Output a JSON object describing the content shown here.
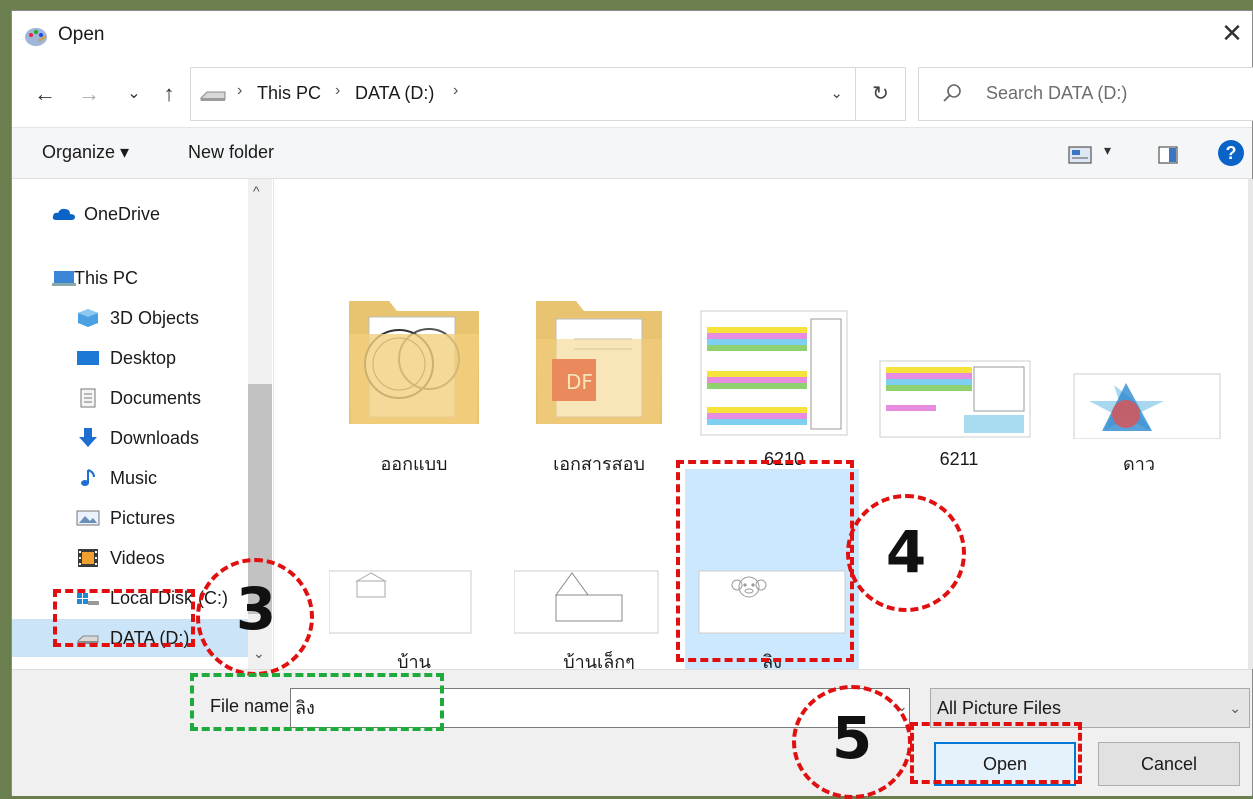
{
  "window": {
    "title": "Open",
    "close_glyph": "✕"
  },
  "nav": {
    "back_glyph": "←",
    "forward_glyph": "→",
    "recent_glyph": "⌄",
    "up_glyph": "↑",
    "breadcrumbs": [
      "This PC",
      "DATA (D:)"
    ],
    "breadcrumb_sep": "›",
    "refresh_glyph": "↻",
    "dropdown_glyph": "⌄"
  },
  "search": {
    "placeholder": "Search DATA (D:)"
  },
  "toolbar": {
    "organize_label": "Organize ▾",
    "new_folder_label": "New folder",
    "view_dd": "▾",
    "help_glyph": "?"
  },
  "sidebar": {
    "items": [
      {
        "label": "OneDrive",
        "icon": "cloud-icon"
      },
      {
        "label": "This PC",
        "icon": "computer-icon"
      },
      {
        "label": "3D Objects",
        "icon": "cube-icon"
      },
      {
        "label": "Desktop",
        "icon": "desktop-icon"
      },
      {
        "label": "Documents",
        "icon": "document-icon"
      },
      {
        "label": "Downloads",
        "icon": "download-icon"
      },
      {
        "label": "Music",
        "icon": "music-icon"
      },
      {
        "label": "Pictures",
        "icon": "picture-icon"
      },
      {
        "label": "Videos",
        "icon": "video-icon"
      },
      {
        "label": "Local Disk (C:)",
        "icon": "local-disk-icon"
      },
      {
        "label": "DATA (D:)",
        "icon": "drive-icon"
      }
    ],
    "selected": "DATA (D:)",
    "scroll_up": "^",
    "scroll_down": "⌄"
  },
  "files": [
    {
      "name": "ออกแบบ",
      "kind": "folder-stamp"
    },
    {
      "name": "เอกสารสอบ",
      "kind": "folder-pdf"
    },
    {
      "name": "6210",
      "kind": "spreadsheet-image"
    },
    {
      "name": "6211",
      "kind": "spreadsheet-image"
    },
    {
      "name": "ดาว",
      "kind": "star-image"
    },
    {
      "name": "บ้าน",
      "kind": "house-image"
    },
    {
      "name": "บ้านเล็กๆ",
      "kind": "small-house-image"
    },
    {
      "name": "ลิง",
      "kind": "monkey-image"
    }
  ],
  "selected_file": "ลิง",
  "bottom": {
    "file_name_label": "File name:",
    "file_name_value": "ลิง",
    "filter_value": "All Picture Files",
    "dropdown_glyph": "⌄",
    "open_label": "Open",
    "cancel_label": "Cancel"
  },
  "annotations": {
    "step3": "3",
    "step4": "4",
    "step5": "5",
    "color_red": "#e01010",
    "color_green": "#1faa3c"
  },
  "colors": {
    "selection": "#cce8ff",
    "accent": "#0078d7",
    "background": "#6b7f4e"
  }
}
